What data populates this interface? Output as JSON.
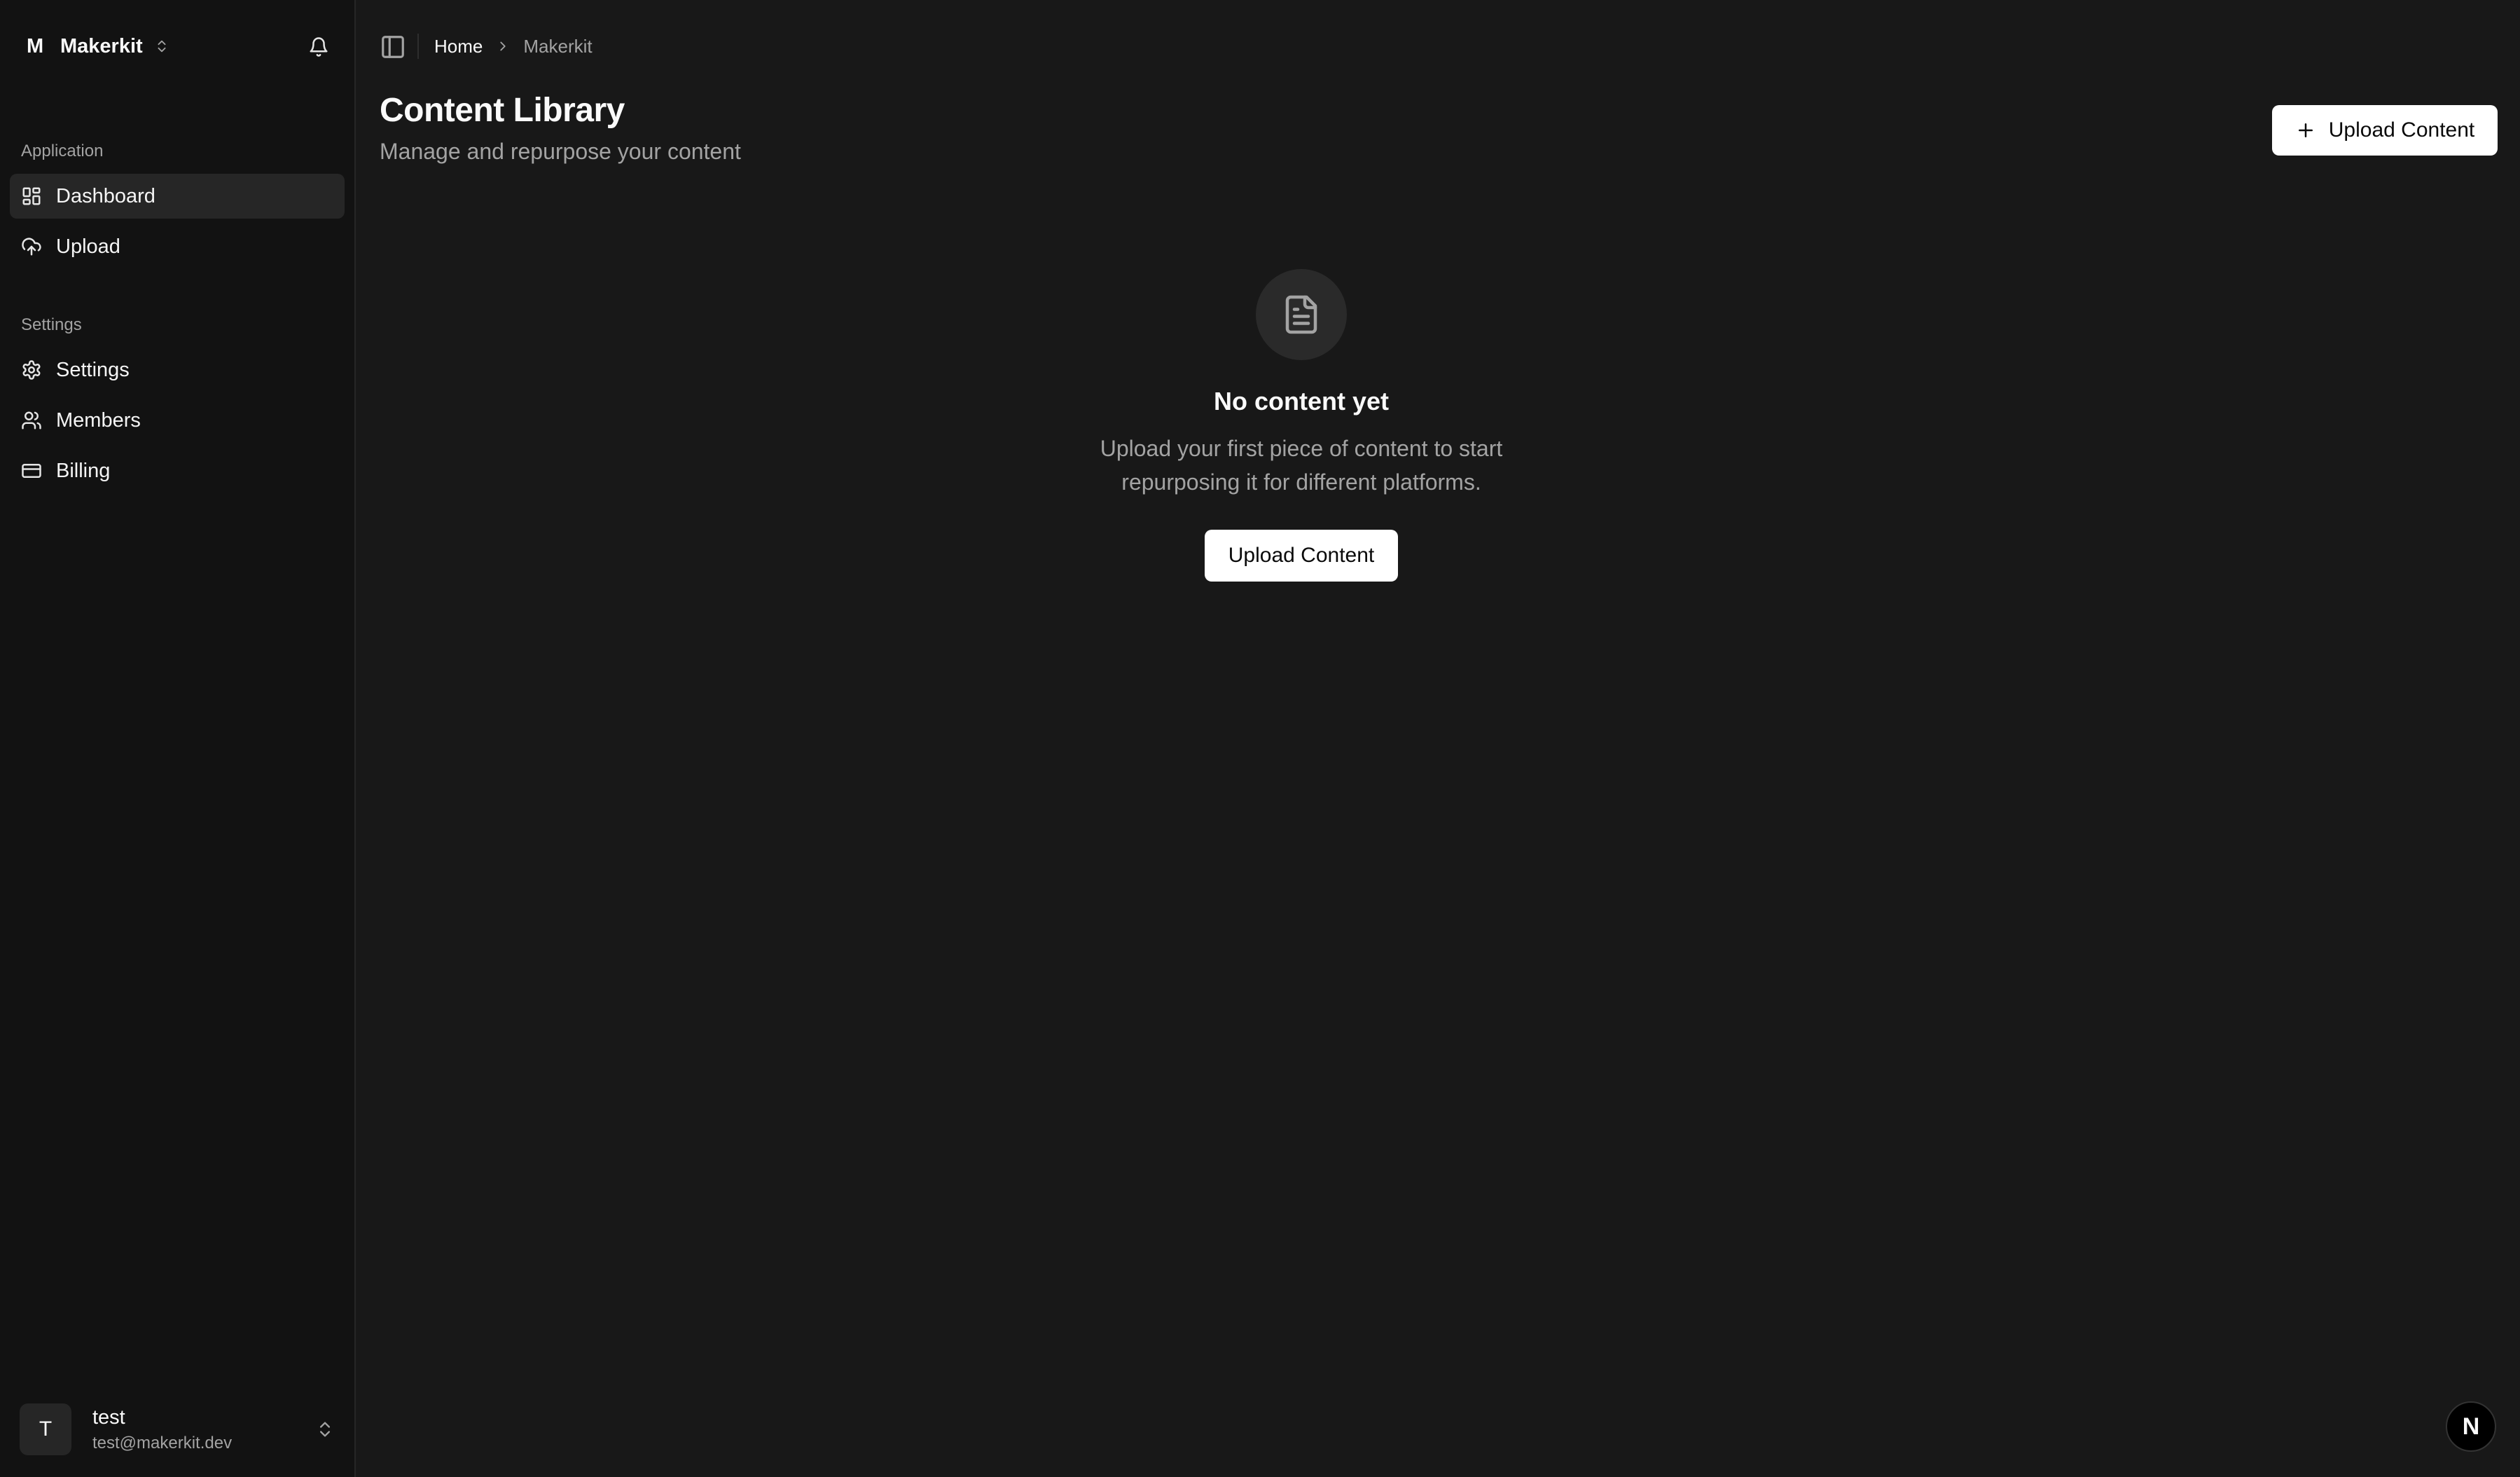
{
  "team": {
    "letter": "M",
    "name": "Makerkit"
  },
  "sidebar": {
    "groups": [
      {
        "label": "Application",
        "items": [
          {
            "label": "Dashboard",
            "icon": "dashboard-icon",
            "active": true
          },
          {
            "label": "Upload",
            "icon": "cloud-upload-icon"
          }
        ]
      },
      {
        "label": "Settings",
        "items": [
          {
            "label": "Settings",
            "icon": "gear-icon"
          },
          {
            "label": "Members",
            "icon": "users-icon"
          },
          {
            "label": "Billing",
            "icon": "credit-card-icon"
          }
        ]
      }
    ]
  },
  "user": {
    "initial": "T",
    "name": "test",
    "email": "test@makerkit.dev"
  },
  "breadcrumb": {
    "home": "Home",
    "current": "Makerkit"
  },
  "page": {
    "title": "Content Library",
    "subtitle": "Manage and repurpose your content",
    "upload_button": "Upload Content"
  },
  "empty_state": {
    "icon": "file-text-icon",
    "title": "No content yet",
    "description": "Upload your first piece of content to start repurposing it for different platforms.",
    "button": "Upload Content"
  },
  "badge": {
    "letter": "N"
  },
  "colors": {
    "background": "#181818",
    "sidebar": "#121212",
    "active_item": "#262626",
    "primary_button": "#ffffff"
  }
}
